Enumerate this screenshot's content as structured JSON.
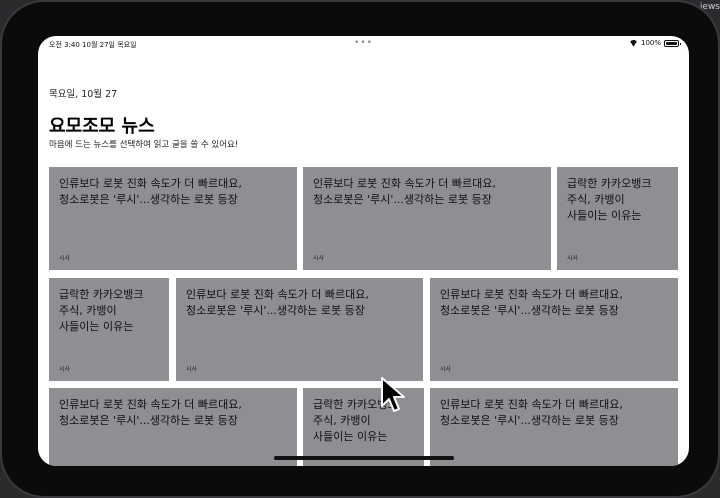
{
  "desktop": {
    "label": "iews"
  },
  "status_bar": {
    "time_date": "오전 3:40   10월 27일 목요일",
    "battery": "100%"
  },
  "header": {
    "date": "목요일, 10월 27",
    "title": "요모조모 뉴스",
    "subtitle": "마음에 드는 뉴스를 선택하여 읽고 글을 쓸 수 있어요!"
  },
  "cards": [
    {
      "title": "인류보다 로봇 진화 속도가 더 빠르대요,\n청소로봇은 '루시'...생각하는 로봇 등장",
      "category": "시사"
    },
    {
      "title": "인류보다 로봇 진화 속도가 더 빠르대요,\n청소로봇은 '루시'...생각하는 로봇 등장",
      "category": "시사"
    },
    {
      "title": "급락한 카카오뱅크\n주식, 카뱅이\n사들이는 이유는",
      "category": "시사"
    },
    {
      "title": "급락한 카카오뱅크\n주식, 카뱅이\n사들이는 이유는",
      "category": "시사"
    },
    {
      "title": "인류보다 로봇 진화 속도가 더 빠르대요,\n청소로봇은 '루시'...생각하는 로봇 등장",
      "category": "시사"
    },
    {
      "title": "인류보다 로봇 진화 속도가 더 빠르대요,\n청소로봇은 '루시'...생각하는 로봇 등장",
      "category": "시사"
    },
    {
      "title": "인류보다 로봇 진화 속도가 더 빠르대요,\n청소로봇은 '루시'...생각하는 로봇 등장",
      "category": ""
    },
    {
      "title": "급락한 카카오뱅크\n주식, 카뱅이\n사들이는 이유는",
      "category": ""
    },
    {
      "title": "인류보다 로봇 진화 속도가 더 빠르대요,\n청소로봇은 '루시'...생각하는 로봇 등장",
      "category": ""
    }
  ],
  "icons": {
    "wifi": "wifi-icon",
    "battery": "battery-icon",
    "cursor": "pointer-cursor-icon",
    "multitask": "multitasking-dots-icon"
  }
}
